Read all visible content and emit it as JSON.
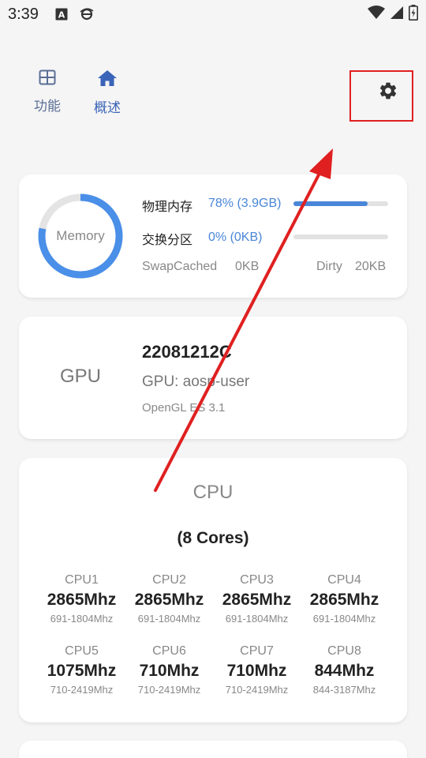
{
  "status_bar": {
    "time": "3:39",
    "icons": [
      "accessibility-a-icon",
      "ie-browser-icon",
      "wifi-icon",
      "signal-icon",
      "battery-icon"
    ]
  },
  "nav": {
    "tabs": [
      {
        "label": "功能",
        "icon": "grid-icon"
      },
      {
        "label": "概述",
        "icon": "home-icon"
      }
    ],
    "settings_icon": "gear-icon"
  },
  "memory": {
    "ring_label": "Memory",
    "physical": {
      "label": "物理内存",
      "value": "78% (3.9GB)",
      "fraction": 0.78
    },
    "swap": {
      "label": "交换分区",
      "value": "0% (0KB)",
      "fraction": 0.0
    },
    "swap_cached": {
      "label": "SwapCached",
      "value": "0KB"
    },
    "dirty": {
      "label": "Dirty",
      "value": "20KB"
    }
  },
  "gpu": {
    "title": "GPU",
    "model": "22081212C",
    "renderer": "GPU: aosp-user",
    "opengl": "OpenGL ES 3.1"
  },
  "cpu": {
    "title": "CPU",
    "cores": "(8 Cores)",
    "cores_list": [
      {
        "name": "CPU1",
        "freq": "2865Mhz",
        "range": "691-1804Mhz"
      },
      {
        "name": "CPU2",
        "freq": "2865Mhz",
        "range": "691-1804Mhz"
      },
      {
        "name": "CPU3",
        "freq": "2865Mhz",
        "range": "691-1804Mhz"
      },
      {
        "name": "CPU4",
        "freq": "2865Mhz",
        "range": "691-1804Mhz"
      },
      {
        "name": "CPU5",
        "freq": "1075Mhz",
        "range": "710-2419Mhz"
      },
      {
        "name": "CPU6",
        "freq": "710Mhz",
        "range": "710-2419Mhz"
      },
      {
        "name": "CPU7",
        "freq": "710Mhz",
        "range": "710-2419Mhz"
      },
      {
        "name": "CPU8",
        "freq": "844Mhz",
        "range": "844-3187Mhz"
      }
    ]
  },
  "colors": {
    "accent": "#4a86d8",
    "annotation_red": "#e02020"
  }
}
